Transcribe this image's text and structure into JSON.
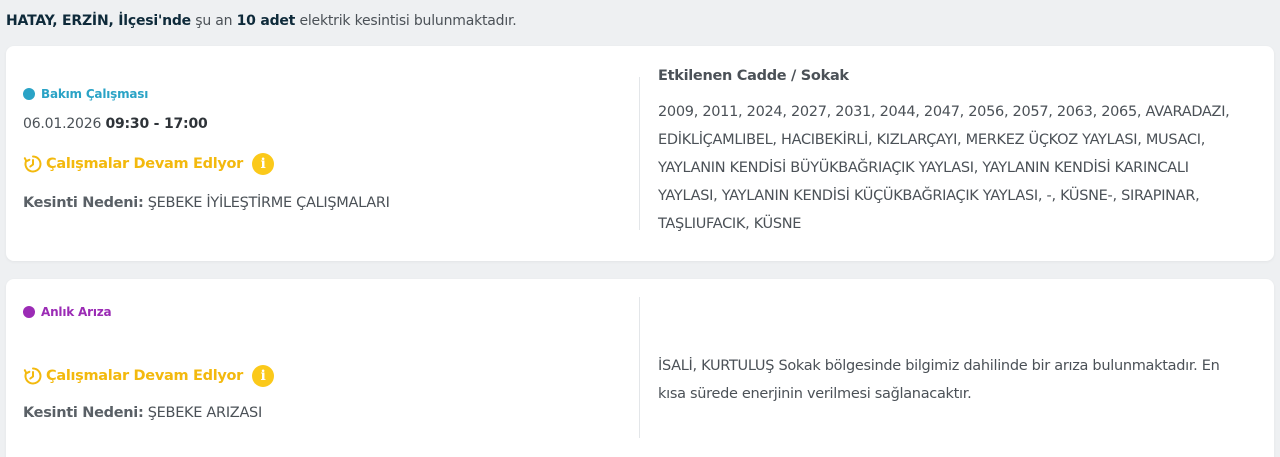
{
  "summary": {
    "location": "HATAY, ERZİN, İlçesi'nde",
    "pre": "şu an",
    "count": "10 adet",
    "post": "elektrik kesintisi bulunmaktadır."
  },
  "colors": {
    "maintenance": "#2aa3c6",
    "fault": "#9b2bb5",
    "status": "#f3b90e"
  },
  "outages": [
    {
      "type_label": "Bakım Çalışması",
      "date": "06.01.2026",
      "time": "09:30 - 17:00",
      "status": "Çalışmalar Devam Edlyor",
      "status_icon": "clock-rotate-icon",
      "info_icon": "info-icon",
      "info_glyph": "i",
      "reason_label": "Kesinti Nedeni:",
      "reason": "ŞEBEKE İYİLEŞTİRME ÇALIŞMALARI",
      "affected_title": "Etkilenen Cadde / Sokak",
      "affected_lines": [
        "2009, 2011, 2024, 2027, 2031, 2044, 2047, 2056, 2057, 2063, 2065, AVARADAZI,",
        "EDİKLİÇAMLIBEL, HACIBEKİRLİ, KIZLARÇAYI, MERKEZ ÜÇKOZ YAYLASI, MUSACI,",
        "YAYLANIN KENDİSİ BÜYÜKBAĞRIAÇIK YAYLASI, YAYLANIN KENDİSİ KARINCALI",
        "YAYLASI, YAYLANIN KENDİSİ KÜÇÜKBAĞRIAÇIK YAYLASI, -, KÜSNE-, SIRAPINAR,",
        "TAŞLIUFACIK, KÜSNE"
      ]
    },
    {
      "type_label": "Anlık Arıza",
      "status": "Çalışmalar Devam Edlyor",
      "status_icon": "clock-rotate-icon",
      "info_icon": "info-icon",
      "info_glyph": "i",
      "reason_label": "Kesinti Nedeni:",
      "reason": "ŞEBEKE ARIZASI",
      "description_lines": [
        "İSALİ, KURTULUŞ Sokak bölgesinde bilgimiz dahilinde bir arıza bulunmaktadır. En",
        "kısa sürede enerjinin verilmesi sağlanacaktır."
      ]
    }
  ]
}
